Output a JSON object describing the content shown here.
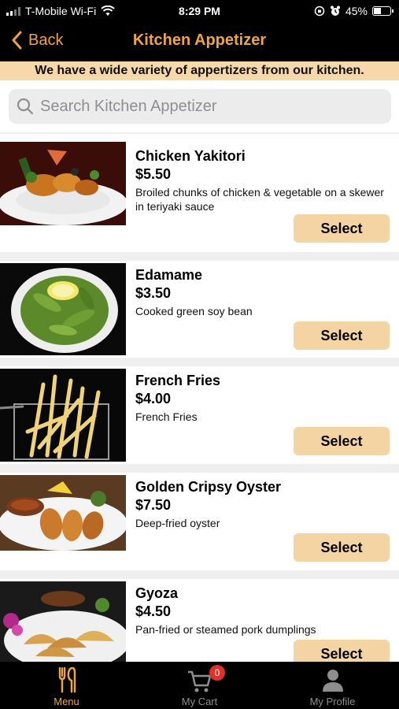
{
  "status_bar": {
    "carrier": "T-Mobile Wi-Fi",
    "time": "8:29 PM",
    "battery": "45%",
    "battery_level": 0.45
  },
  "nav": {
    "back_label": "Back",
    "title": "Kitchen Appetizer"
  },
  "banner": "We have a wide variety of appertizers from our kitchen.",
  "search": {
    "placeholder": "Search Kitchen Appetizer",
    "value": ""
  },
  "items": [
    {
      "name": "Chicken Yakitori",
      "price": "$5.50",
      "description": "Broiled chunks of chicken & vegetable on a skewer in teriyaki sauce",
      "button": "Select"
    },
    {
      "name": "Edamame",
      "price": "$3.50",
      "description": "Cooked green soy bean",
      "button": "Select"
    },
    {
      "name": "French Fries",
      "price": "$4.00",
      "description": "French Fries",
      "button": "Select"
    },
    {
      "name": "Golden Cripsy Oyster",
      "price": "$7.50",
      "description": "Deep-fried oyster",
      "button": "Select"
    },
    {
      "name": "Gyoza",
      "price": "$4.50",
      "description": "Pan-fried or steamed pork dumplings",
      "button": "Select"
    }
  ],
  "tabbar": {
    "menu": "Menu",
    "cart": "My Cart",
    "cart_count": "0",
    "profile": "My Profile"
  },
  "colors": {
    "accent": "#f0a447",
    "banner_bg": "#f6d8ab",
    "button_bg": "#f5d4a4",
    "badge": "#e0302a"
  }
}
